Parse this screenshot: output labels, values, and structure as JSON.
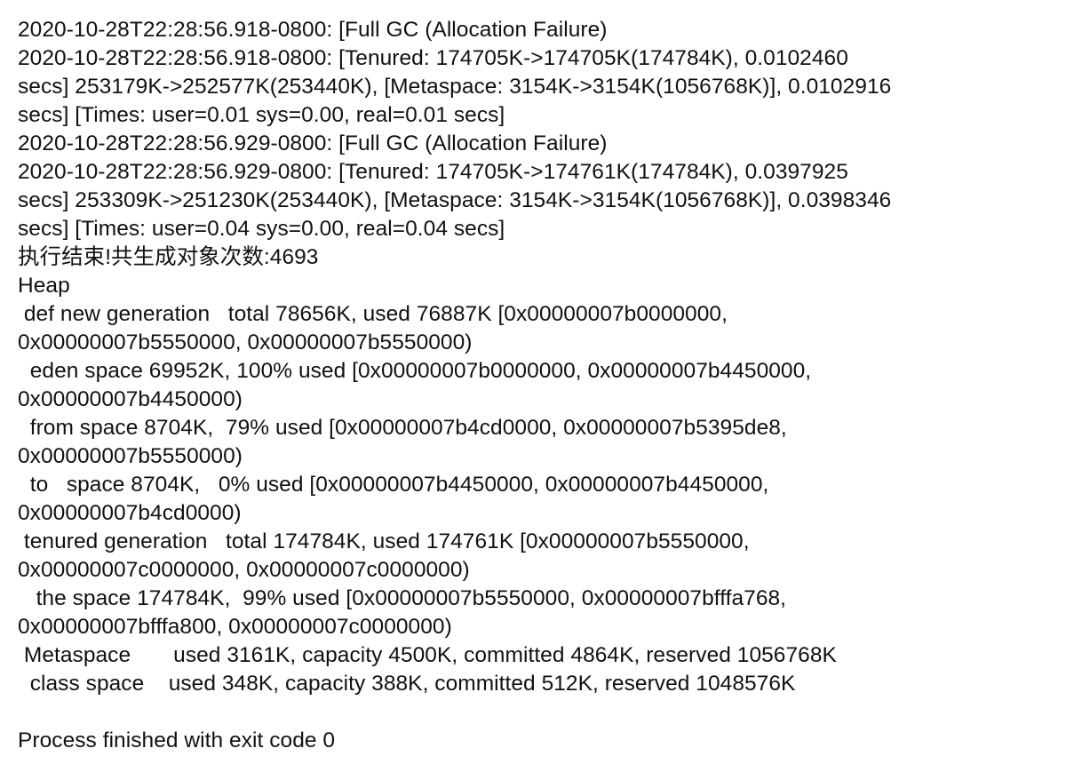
{
  "console": {
    "lines": [
      "2020-10-28T22:28:56.918-0800: [Full GC (Allocation Failure)",
      "2020-10-28T22:28:56.918-0800: [Tenured: 174705K->174705K(174784K), 0.0102460",
      "secs] 253179K->252577K(253440K), [Metaspace: 3154K->3154K(1056768K)], 0.0102916",
      "secs] [Times: user=0.01 sys=0.00, real=0.01 secs]",
      "2020-10-28T22:28:56.929-0800: [Full GC (Allocation Failure)",
      "2020-10-28T22:28:56.929-0800: [Tenured: 174705K->174761K(174784K), 0.0397925",
      "secs] 253309K->251230K(253440K), [Metaspace: 3154K->3154K(1056768K)], 0.0398346",
      "secs] [Times: user=0.04 sys=0.00, real=0.04 secs]",
      "执行结束!共生成对象次数:4693",
      "Heap",
      " def new generation   total 78656K, used 76887K [0x00000007b0000000,",
      "0x00000007b5550000, 0x00000007b5550000)",
      "  eden space 69952K, 100% used [0x00000007b0000000, 0x00000007b4450000,",
      "0x00000007b4450000)",
      "  from space 8704K,  79% used [0x00000007b4cd0000, 0x00000007b5395de8,",
      "0x00000007b5550000)",
      "  to   space 8704K,   0% used [0x00000007b4450000, 0x00000007b4450000,",
      "0x00000007b4cd0000)",
      " tenured generation   total 174784K, used 174761K [0x00000007b5550000,",
      "0x00000007c0000000, 0x00000007c0000000)",
      "   the space 174784K,  99% used [0x00000007b5550000, 0x00000007bfffa768,",
      "0x00000007bfffa800, 0x00000007c0000000)",
      " Metaspace       used 3161K, capacity 4500K, committed 4864K, reserved 1056768K",
      "  class space    used 348K, capacity 388K, committed 512K, reserved 1048576K",
      "",
      "Process finished with exit code 0"
    ]
  }
}
